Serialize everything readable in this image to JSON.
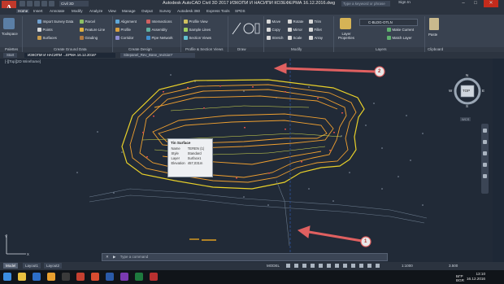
{
  "titlebar": {
    "app_letter": "A",
    "workspace": "Civil 3D",
    "title": "Autodesk AutoCAD Civil 3D 2017    ИЗКОПИ И НАСИПИ КОЗЕФЕРМА 16.12.2016.dwg",
    "search_placeholder": "Type a keyword or phrase",
    "signin": "Sign In"
  },
  "menu": [
    "Home",
    "Insert",
    "Annotate",
    "Modify",
    "Analyze",
    "View",
    "Manage",
    "Output",
    "Survey",
    "Autodesk 360",
    "Express Tools",
    "SPDS"
  ],
  "ribbon": {
    "toolspace": "Toolspace",
    "palettes_col": [
      "Import Survey Data",
      "Points",
      "Surfaces"
    ],
    "ground_col": [
      "Parcel",
      "Feature Line",
      "Grading"
    ],
    "design_col1": [
      "Alignment",
      "Profile",
      "Corridor"
    ],
    "design_col2": [
      "Intersections",
      "Assembly",
      "Pipe Network"
    ],
    "section_col": [
      "Profile View",
      "Sample Lines",
      "Section Views"
    ],
    "modify_col1": [
      "Move",
      "Copy",
      "Stretch"
    ],
    "modify_col2": [
      "Rotate",
      "Mirror",
      "Scale"
    ],
    "modify_col3": [
      "Trim",
      "Fillet",
      "Array"
    ],
    "layer_props": "Layer Properties",
    "layer_current": "C-BLDG-OTLN",
    "layer_ops": [
      "Make Current",
      "Match Layer"
    ],
    "paste": "Paste",
    "panels": [
      "Palettes",
      "Create Ground Data",
      "Create Design",
      "Profile & Section Views",
      "Draw",
      "Modify",
      "Layers",
      "Clipboard"
    ]
  },
  "file_tabs": [
    "Start",
    "ИЗКОПИ И НАСИПИ ...ЕРМА 16.12.2016*",
    "Sitepanel_Rev_Base_revision*"
  ],
  "viewport_label": "[-][Top][2D Wireframe]",
  "viewcube": {
    "face": "TOP",
    "n": "N",
    "s": "S",
    "e": "E",
    "w": "W",
    "wcs": "WCS"
  },
  "annotations": {
    "callout_1": "1",
    "callout_2": "2"
  },
  "tooltip": {
    "title": "Tin Surface",
    "rows": [
      {
        "k": "Name",
        "v": "TEREN (1)"
      },
      {
        "k": "Style",
        "v": "Standard"
      },
      {
        "k": "Layer",
        "v": "Surface1"
      },
      {
        "k": "Elevation",
        "v": "457,031m"
      }
    ]
  },
  "command_placeholder": "Type a command",
  "layout_tabs": [
    "Model",
    "Layout1",
    "Layout2"
  ],
  "status": {
    "model": "MODEL",
    "scale": "1:1000",
    "value": "3.500"
  },
  "taskbar": {
    "lang": "БГР\nBGR",
    "time": "13:10",
    "date": "16.12.2016"
  },
  "colors": {
    "accent": "#c0392b",
    "contour": "#f0c030",
    "boundary": "#e8d02a",
    "arrow": "#e06060"
  }
}
